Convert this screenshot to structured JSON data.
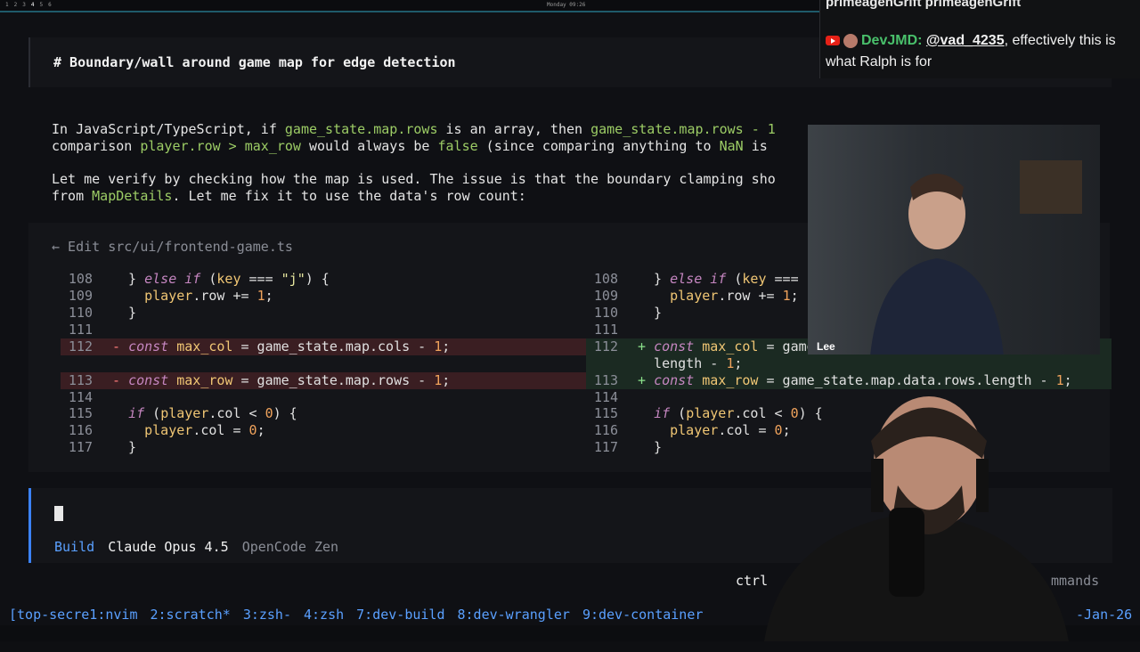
{
  "topbar": {
    "workspaces": [
      "1",
      "2",
      "3",
      "4",
      "5",
      "6"
    ],
    "clock": "Monday 09:26"
  },
  "heading": "# Boundary/wall around game map for edge detection",
  "paragraph1": {
    "line1_a": "In JavaScript/TypeScript, if ",
    "line1_b": "game_state.map.rows",
    "line1_c": " is an array, then ",
    "line1_d": "game_state.map.rows - 1",
    "line2_a": "comparison ",
    "line2_b": "player.row > max_row",
    "line2_c": " would always be ",
    "line2_d": "false",
    "line2_e": " (since comparing anything to ",
    "line2_f": "NaN",
    "line2_g": " is"
  },
  "paragraph2": {
    "line1": "Let me verify by checking how the map is used. The issue is that the boundary clamping sho",
    "line2_a": "from ",
    "line2_b": "MapDetails",
    "line2_c": ". Let me fix it to use the data's row count:"
  },
  "edit": {
    "title": "← Edit src/ui/frontend-game.ts",
    "left": [
      {
        "n": "108",
        "t": "  } else if (key === \"j\") {"
      },
      {
        "n": "109",
        "t": "    player.row += 1;"
      },
      {
        "n": "110",
        "t": "  }"
      },
      {
        "n": "111",
        "t": ""
      },
      {
        "n": "112",
        "t": "- const max_col = game_state.map.cols - 1;"
      },
      {
        "n": "113",
        "t": "- const max_row = game_state.map.rows - 1;"
      },
      {
        "n": "114",
        "t": ""
      },
      {
        "n": "115",
        "t": "  if (player.col < 0) {"
      },
      {
        "n": "116",
        "t": "    player.col = 0;"
      },
      {
        "n": "117",
        "t": "  }"
      }
    ],
    "right": [
      {
        "n": "108",
        "t": "  } else if (key === \""
      },
      {
        "n": "109",
        "t": "    player.row += 1;"
      },
      {
        "n": "110",
        "t": "  }"
      },
      {
        "n": "111",
        "t": ""
      },
      {
        "n": "112",
        "t": "+ const max_col = game"
      },
      {
        "n": "",
        "t": "  length - 1;"
      },
      {
        "n": "113",
        "t": "+ const max_row = game_state.map.data.rows.length - 1;"
      },
      {
        "n": "114",
        "t": ""
      },
      {
        "n": "115",
        "t": "  if (player.col < 0) {"
      },
      {
        "n": "116",
        "t": "    player.col = 0;"
      },
      {
        "n": "117",
        "t": "  }"
      }
    ]
  },
  "input": {
    "mode": "Build",
    "model": "Claude Opus 4.5",
    "provider": "OpenCode Zen"
  },
  "hints": {
    "left": "ctrl",
    "right": "mmands"
  },
  "tmux": {
    "windows": [
      "[top-secre1:nvim",
      "2:scratch*",
      "3:zsh-",
      "4:zsh",
      "7:dev-build",
      "8:dev-wrangler",
      "9:dev-container"
    ],
    "date": "-Jan-26"
  },
  "chat": {
    "previous": "primeagenGrift primeagenGrift",
    "user": "DevJMD:",
    "mention": "@vad_4235",
    "message": ", effectively this is what Ralph is for"
  },
  "cam1": {
    "label": "Lee"
  },
  "colors": {
    "accent": "#3b82f6",
    "green": "#9ccc65",
    "delete_bg": "#3a1e22",
    "add_bg": "#1b2a22"
  }
}
